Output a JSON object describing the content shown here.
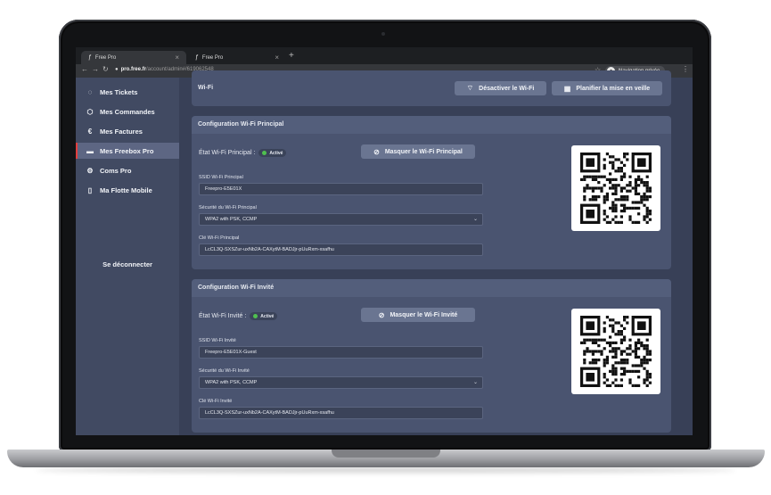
{
  "browser": {
    "tabs": [
      {
        "title": "Free Pro",
        "active": true
      },
      {
        "title": "Free Pro",
        "active": false
      }
    ],
    "url_host": "pro.free.fr",
    "url_path": "/account/admin#/619062548",
    "incognito_label": "Navigation privée"
  },
  "sidebar": {
    "items": [
      {
        "label": "Mes Tickets",
        "icon": "chat-bubble-icon"
      },
      {
        "label": "Mes Commandes",
        "icon": "box-icon"
      },
      {
        "label": "Mes Factures",
        "icon": "euro-invoice-icon"
      },
      {
        "label": "Mes Freebox Pro",
        "icon": "router-icon",
        "active": true
      },
      {
        "label": "Coms Pro",
        "icon": "gear-icon"
      },
      {
        "label": "Ma Flotte Mobile",
        "icon": "mobile-icon"
      }
    ],
    "logout_label": "Se déconnecter"
  },
  "wifi_bar": {
    "title": "Wi-Fi",
    "disable_button": "Désactiver le Wi-Fi",
    "schedule_button": "Planifier la mise en veille"
  },
  "principal": {
    "header": "Configuration Wi-Fi Principal",
    "state_label": "État Wi-Fi Principal :",
    "state_badge": "Activé",
    "hide_button": "Masquer le Wi-Fi Principal",
    "ssid_label": "SSID Wi-Fi Principal",
    "ssid_value": "Freepro-E5E01X",
    "security_label": "Sécurité du Wi-Fi Principal",
    "security_value": "WPA2 with PSK, CCMP",
    "key_label": "Clé Wi-Fi Principal",
    "key_value": "LcCL3Q-SXSZur-uxNb2A-CAXytM-BADJjr-pUuRxm-xsafhu"
  },
  "guest": {
    "header": "Configuration Wi-Fi Invité",
    "state_label": "État Wi-Fi Invité :",
    "state_badge": "Activé",
    "hide_button": "Masquer le Wi-Fi Invité",
    "ssid_label": "SSID Wi-Fi Invité",
    "ssid_value": "Freepro-E5E01X-Guest",
    "security_label": "Sécurité du Wi-Fi Invité",
    "security_value": "WPA2 with PSK, CCMP",
    "key_label": "Clé Wi-Fi Invité",
    "key_value": "LcCL3Q-SXSZur-uxNb2A-CAXytM-BADJjr-pUuRxm-xsafhu"
  },
  "colors": {
    "sidebar_bg": "#414a62",
    "main_bg": "#384057",
    "card_bg": "#4a5470",
    "button_bg": "#6a7591",
    "active_accent": "#e23e3e",
    "status_green": "#4fc04f"
  }
}
